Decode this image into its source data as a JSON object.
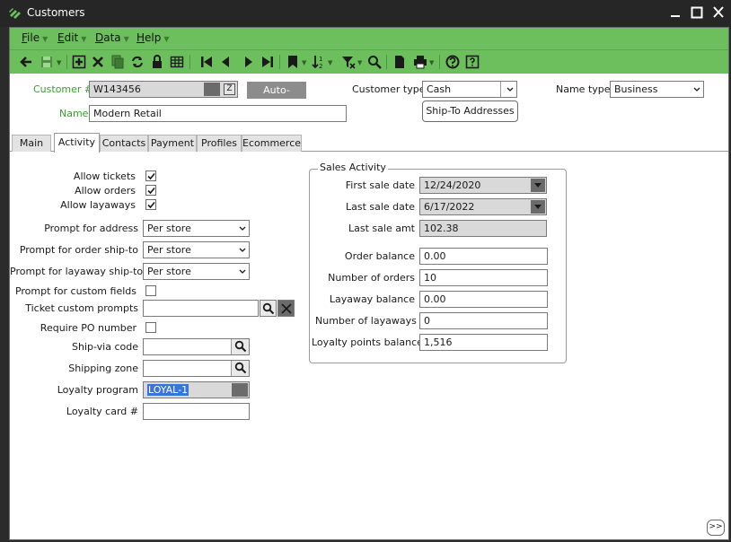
{
  "window": {
    "title": "Customers"
  },
  "menu": [
    {
      "label": "File",
      "u": "F",
      "rest": "ile"
    },
    {
      "label": "Edit",
      "u": "E",
      "rest": "dit"
    },
    {
      "label": "Data",
      "u": "D",
      "rest": "ata"
    },
    {
      "label": "Help",
      "u": "H",
      "rest": "elp"
    }
  ],
  "header": {
    "customer_label": "Customer #",
    "customer_value": "W143456",
    "auto_assign": "Auto-assign",
    "name_label": "Name",
    "name_value": "Modern Retail",
    "customer_type_label": "Customer type",
    "customer_type_value": "Cash",
    "ship_to": "Ship-To Addresses",
    "name_type_label": "Name type",
    "name_type_value": "Business"
  },
  "tabs": [
    "Main",
    "Activity",
    "Contacts",
    "Payment",
    "Profiles",
    "Ecommerce"
  ],
  "active_tab": "Activity",
  "left": {
    "allow_tickets": "Allow tickets",
    "allow_orders": "Allow orders",
    "allow_layaways": "Allow layaways",
    "prompt_address_label": "Prompt for address",
    "prompt_address_value": "Per store",
    "prompt_order_label": "Prompt for order ship-to",
    "prompt_order_value": "Per store",
    "prompt_layaway_label": "Prompt for layaway ship-to",
    "prompt_layaway_value": "Per store",
    "prompt_custom_label": "Prompt for custom fields",
    "ticket_custom_label": "Ticket custom prompts",
    "ticket_custom_value": "",
    "require_po_label": "Require PO number",
    "ship_via_label": "Ship-via code",
    "ship_via_value": "",
    "shipping_zone_label": "Shipping zone",
    "shipping_zone_value": "",
    "loyalty_program_label": "Loyalty program",
    "loyalty_program_value": "LOYAL-1",
    "loyalty_card_label": "Loyalty card #",
    "loyalty_card_value": ""
  },
  "sales": {
    "title": "Sales Activity",
    "first_sale_label": "First sale date",
    "first_sale_value": "12/24/2020",
    "last_sale_label": "Last sale date",
    "last_sale_value": "6/17/2022",
    "last_amt_label": "Last sale amt",
    "last_amt_value": "102.38",
    "order_balance_label": "Order balance",
    "order_balance_value": "0.00",
    "num_orders_label": "Number of orders",
    "num_orders_value": "10",
    "layaway_balance_label": "Layaway balance",
    "layaway_balance_value": "0.00",
    "num_layaways_label": "Number of layaways",
    "num_layaways_value": "0",
    "loyalty_points_label": "Loyalty points balance",
    "loyalty_points_value": "1,516"
  },
  "expand": ">>",
  "colors": {
    "accent_green": "#6cbf5c",
    "label_green": "#3a9a2d",
    "titlebar": "#262626"
  }
}
